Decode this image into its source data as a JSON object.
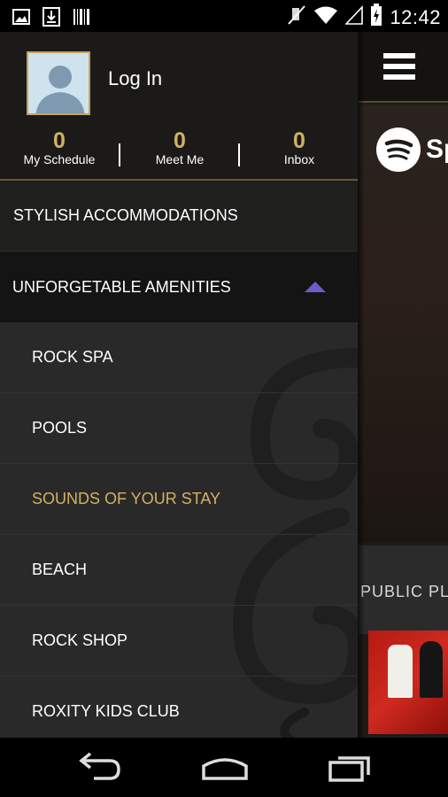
{
  "status_bar": {
    "time": "12:42",
    "left_icons": [
      "image-icon",
      "download-icon",
      "barcode-icon"
    ],
    "right_icons": [
      "mute-icon",
      "wifi-icon",
      "signal-icon",
      "battery-charging-icon"
    ]
  },
  "drawer": {
    "login_label": "Log In",
    "stats": [
      {
        "count": "0",
        "label": "My Schedule"
      },
      {
        "count": "0",
        "label": "Meet Me"
      },
      {
        "count": "0",
        "label": "Inbox"
      }
    ],
    "menu": {
      "stylish": "STYLISH ACCOMMODATIONS",
      "amenities": "UNFORGETABLE AMENITIES",
      "sub_items": [
        "ROCK SPA",
        "POOLS",
        "SOUNDS OF YOUR STAY",
        "BEACH",
        "ROCK SHOP",
        "ROXITY KIDS CLUB"
      ]
    }
  },
  "background_app": {
    "spotify_text": "Sp",
    "section_label": "PUBLIC PL"
  },
  "colors": {
    "accent_gold": "#d3b164",
    "arrow_purple": "#6d5cc7"
  }
}
